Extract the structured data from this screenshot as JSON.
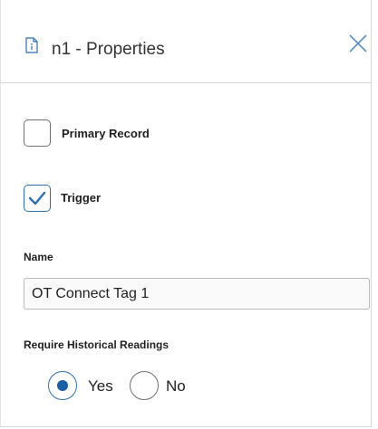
{
  "panel": {
    "title": "n1 - Properties",
    "icons": {
      "doc": "document-info-icon",
      "close": "close-icon"
    }
  },
  "fields": {
    "primary_record": {
      "label": "Primary Record",
      "checked": false
    },
    "trigger": {
      "label": "Trigger",
      "checked": true
    },
    "name": {
      "label": "Name",
      "value": "OT Connect Tag 1"
    },
    "require_historical": {
      "label": "Require Historical Readings",
      "options": [
        {
          "label": "Yes",
          "selected": true
        },
        {
          "label": "No",
          "selected": false
        }
      ]
    }
  },
  "colors": {
    "accent": "#2f6fb0",
    "radio_fill": "#1a5fa6",
    "border": "#d6d6d6"
  }
}
